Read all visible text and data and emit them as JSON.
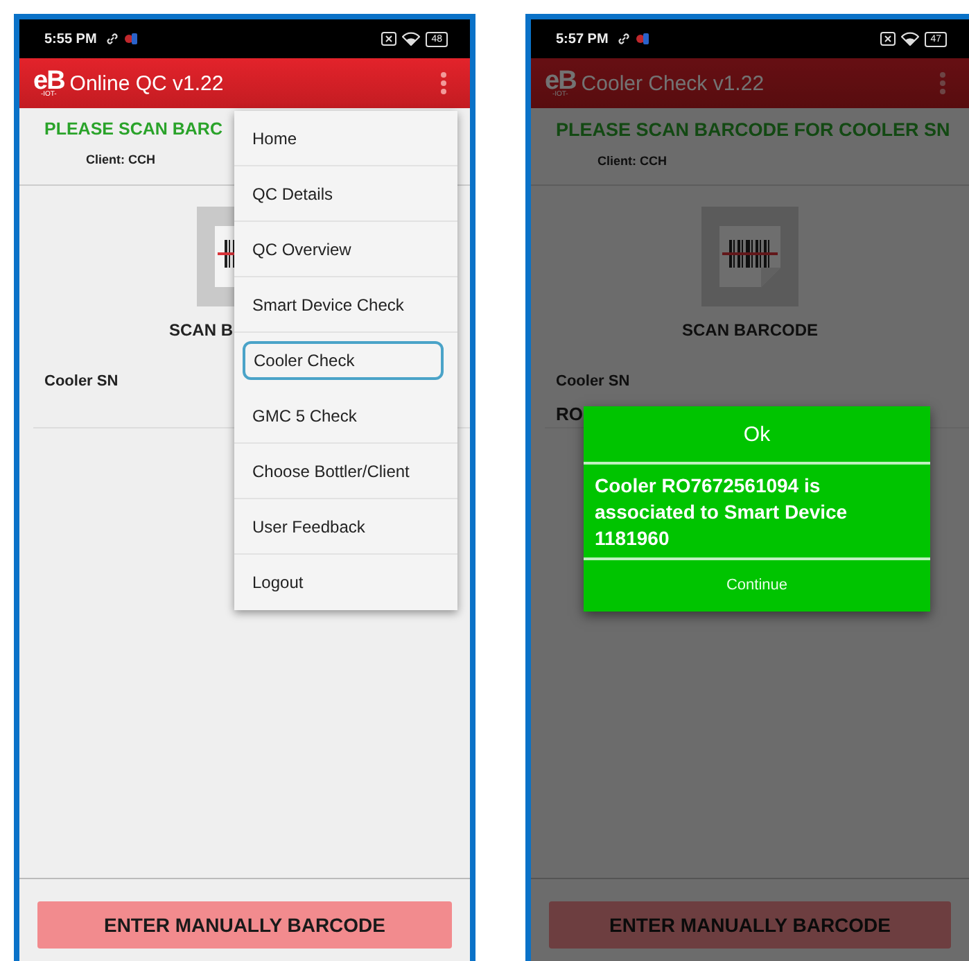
{
  "phones": [
    {
      "status_bar": {
        "time": "5:55 PM",
        "battery": "48"
      },
      "app_bar": {
        "logo": "eB",
        "logo_sub": "-IOT-",
        "title": "Online QC v1.22"
      },
      "header": {
        "title": "PLEASE SCAN BARC",
        "client": "Client: CCH"
      },
      "scan_label": "SCAN B",
      "field": {
        "label": "Cooler SN"
      },
      "bottom_button": "ENTER MANUALLY BARCODE",
      "dimmed": false,
      "menu": {
        "items": [
          {
            "label": "Home",
            "selected": false
          },
          {
            "label": "QC Details",
            "selected": false
          },
          {
            "label": "QC Overview",
            "selected": false
          },
          {
            "label": "Smart Device Check",
            "selected": false
          },
          {
            "label": "Cooler Check",
            "selected": true
          },
          {
            "label": "GMC 5 Check",
            "selected": false
          },
          {
            "label": "Choose Bottler/Client",
            "selected": false
          },
          {
            "label": "User Feedback",
            "selected": false
          },
          {
            "label": "Logout",
            "selected": false
          }
        ]
      }
    },
    {
      "status_bar": {
        "time": "5:57 PM",
        "battery": "47"
      },
      "app_bar": {
        "logo": "eB",
        "logo_sub": "-IOT-",
        "title": "Cooler Check v1.22"
      },
      "header": {
        "title": "PLEASE SCAN BARCODE FOR COOLER SN",
        "client": "Client: CCH"
      },
      "scan_label": "SCAN BARCODE",
      "field": {
        "label": "Cooler SN",
        "value": "RO"
      },
      "bottom_button": "ENTER MANUALLY BARCODE",
      "dimmed": true,
      "dialog": {
        "title": "Ok",
        "message": "Cooler RO7672561094 is associated to Smart Device 1181960",
        "button": "Continue"
      }
    }
  ]
}
